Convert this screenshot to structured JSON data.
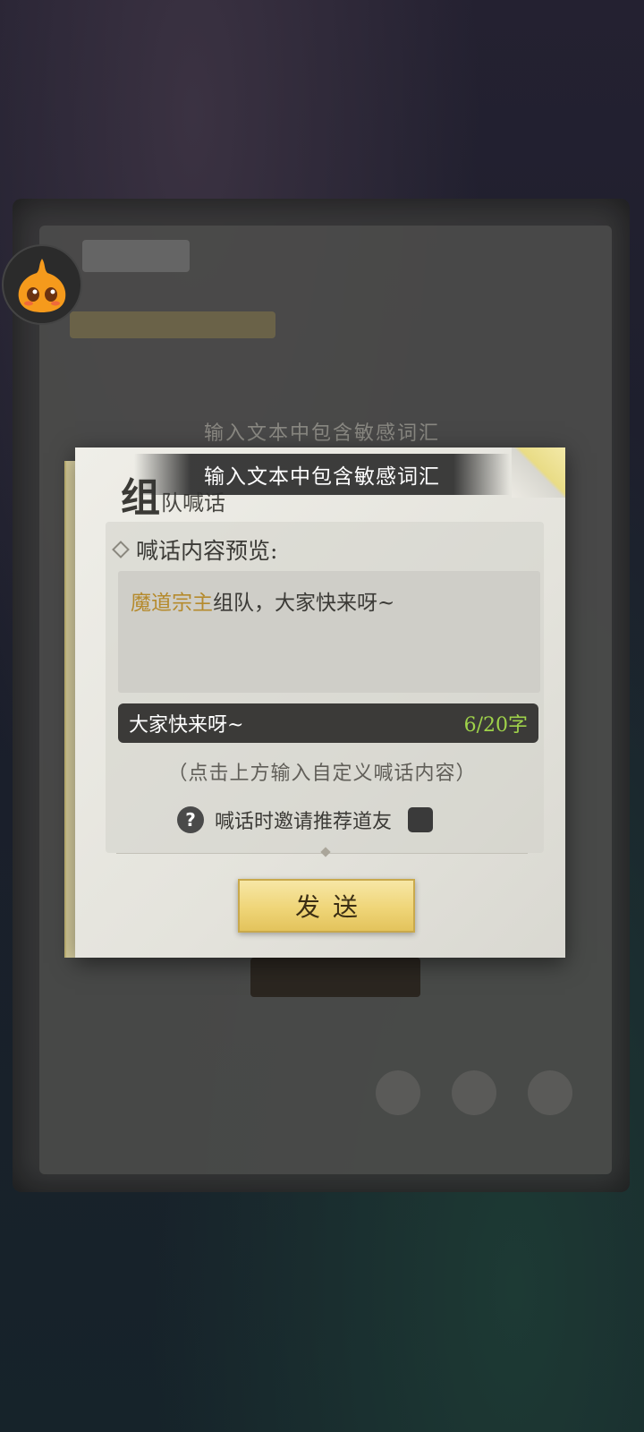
{
  "toast": {
    "ghost_text": "输入文本中包含敏感词汇",
    "text": "输入文本中包含敏感词汇"
  },
  "dialog": {
    "title_big": "组",
    "title_rest": "队喊话",
    "preview_label": "喊话内容预览:",
    "preview_name": "魔道宗主",
    "preview_body": "组队，大家快来呀~",
    "input_value": "大家快来呀~",
    "char_count": "6/20字",
    "hint": "（点击上方输入自定义喊话内容）",
    "invite_label": "喊话时邀请推荐道友",
    "invite_checked": true,
    "send_label": "发送",
    "help_glyph": "?"
  },
  "colors": {
    "name_highlight": "#b58a2c",
    "counter": "#9fd24a",
    "send_button": "#efd578"
  },
  "icons": {
    "floating_assistant": "orange-blob-icon",
    "help": "question-icon"
  }
}
